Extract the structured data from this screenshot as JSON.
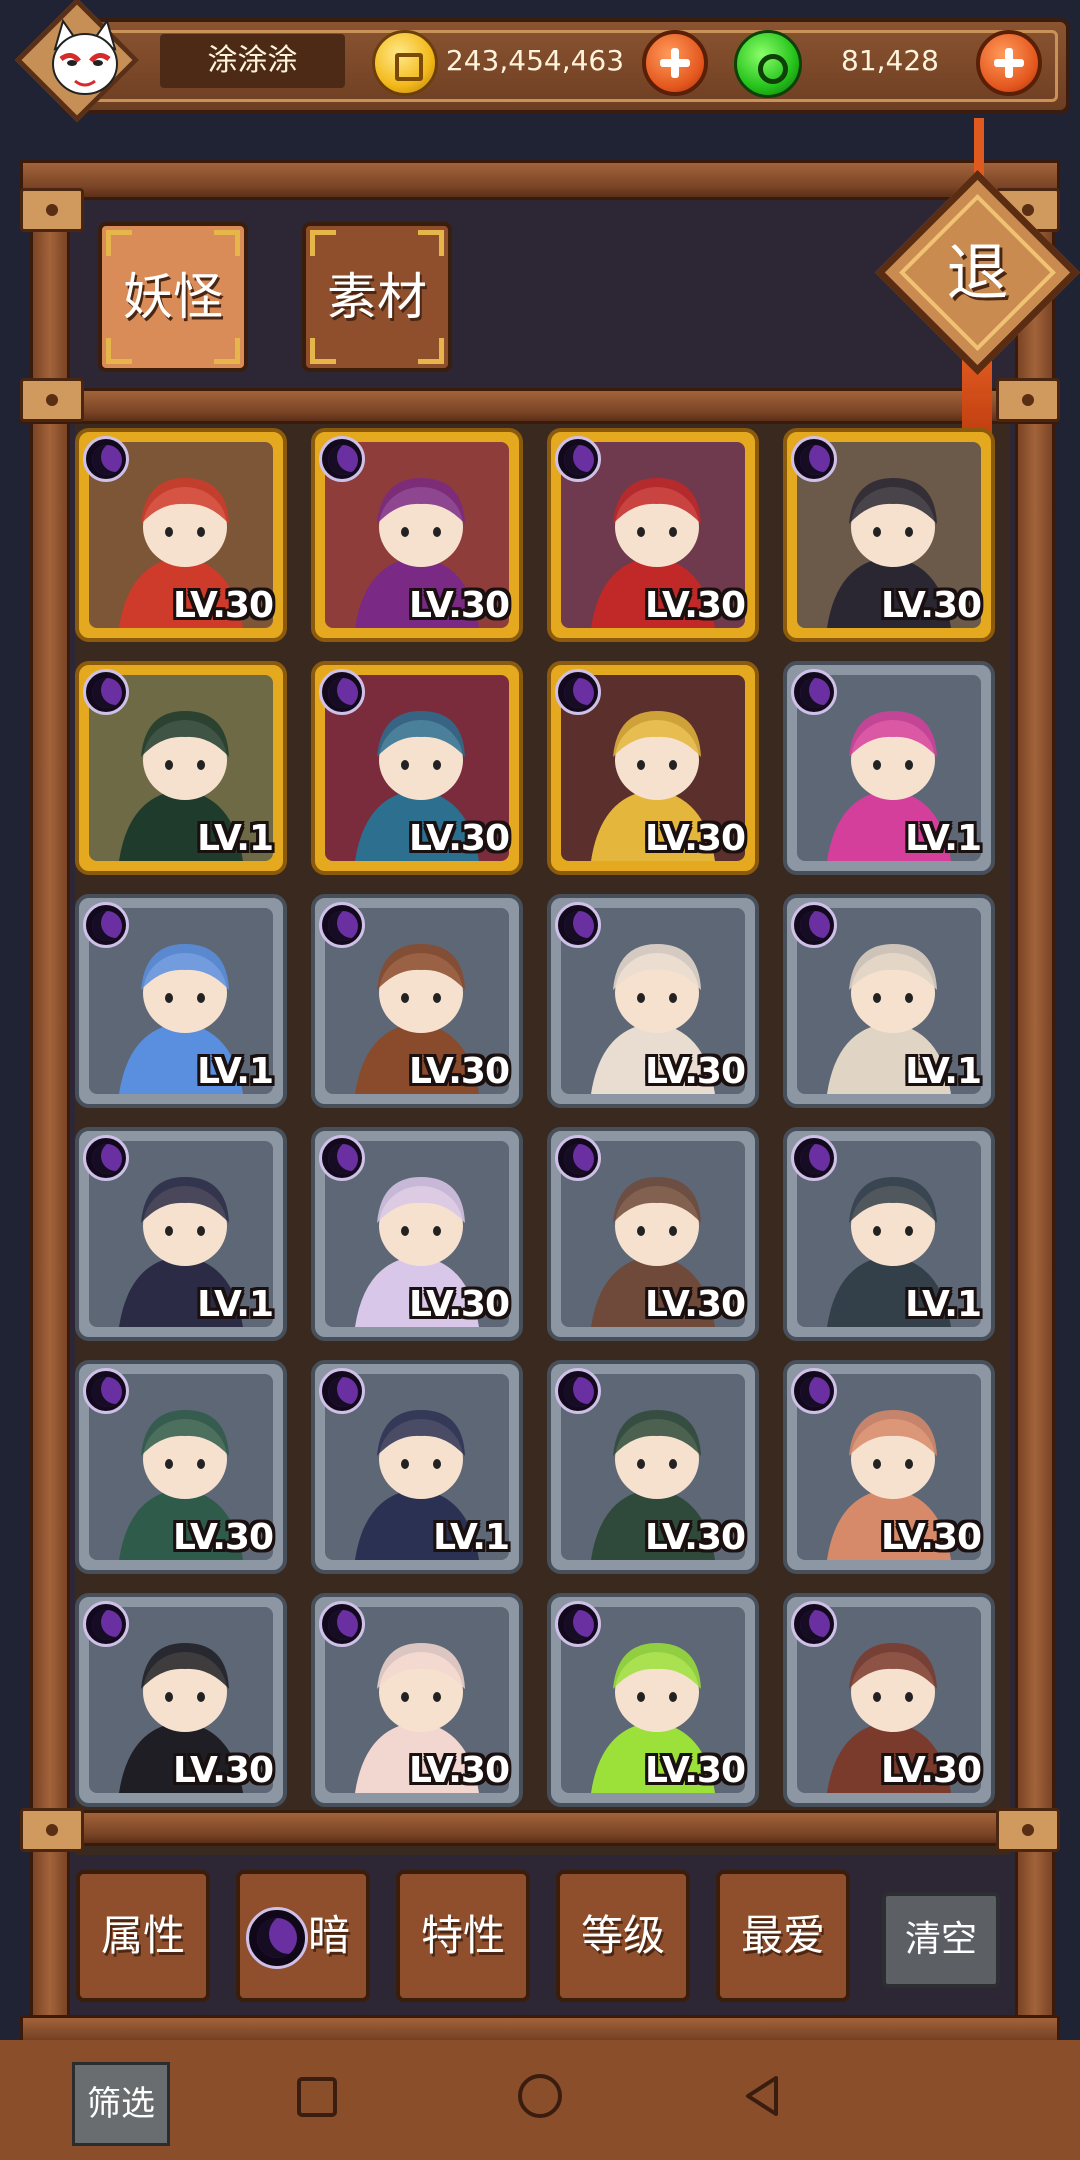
{
  "player": {
    "name": "涂涂涂",
    "gold": "243,454,463",
    "gems": "81,428"
  },
  "tabs": [
    {
      "label": "妖怪",
      "active": true
    },
    {
      "label": "素材",
      "active": false
    }
  ],
  "exit_label": "退",
  "cards": [
    {
      "level": "LV.30",
      "frame": "gold",
      "bg": "#7d5537",
      "accent": "#cf3b2a"
    },
    {
      "level": "LV.30",
      "frame": "gold",
      "bg": "#8e3d3b",
      "accent": "#7a2a84"
    },
    {
      "level": "LV.30",
      "frame": "gold",
      "bg": "#6f3a4e",
      "accent": "#c12828"
    },
    {
      "level": "LV.30",
      "frame": "gold",
      "bg": "#6b5a49",
      "accent": "#2a2733"
    },
    {
      "level": "LV.1",
      "frame": "gold",
      "bg": "#6d6a45",
      "accent": "#1f3b2c"
    },
    {
      "level": "LV.30",
      "frame": "gold",
      "bg": "#7a2c3c",
      "accent": "#2c6f8f"
    },
    {
      "level": "LV.30",
      "frame": "gold",
      "bg": "#5b2f2c",
      "accent": "#e4b63c"
    },
    {
      "level": "LV.1",
      "frame": "silver",
      "bg": "#5d6775",
      "accent": "#d53f9c"
    },
    {
      "level": "LV.1",
      "frame": "silver",
      "bg": "#5d6775",
      "accent": "#5a8fe0"
    },
    {
      "level": "LV.30",
      "frame": "silver",
      "bg": "#5d6775",
      "accent": "#8a4a2c"
    },
    {
      "level": "LV.30",
      "frame": "silver",
      "bg": "#5d6775",
      "accent": "#e9dcd0"
    },
    {
      "level": "LV.1",
      "frame": "silver",
      "bg": "#5d6775",
      "accent": "#e0d4c4"
    },
    {
      "level": "LV.1",
      "frame": "silver",
      "bg": "#5d6775",
      "accent": "#2b2b46"
    },
    {
      "level": "LV.30",
      "frame": "silver",
      "bg": "#5d6775",
      "accent": "#d8c7e8"
    },
    {
      "level": "LV.30",
      "frame": "silver",
      "bg": "#5d6775",
      "accent": "#6f4a3a"
    },
    {
      "level": "LV.1",
      "frame": "silver",
      "bg": "#5d6775",
      "accent": "#33404a"
    },
    {
      "level": "LV.30",
      "frame": "silver",
      "bg": "#5d6775",
      "accent": "#2f5b4a"
    },
    {
      "level": "LV.1",
      "frame": "silver",
      "bg": "#5d6775",
      "accent": "#2b3152"
    },
    {
      "level": "LV.30",
      "frame": "silver",
      "bg": "#5d6775",
      "accent": "#2f4a3a"
    },
    {
      "level": "LV.30",
      "frame": "silver",
      "bg": "#5d6775",
      "accent": "#d78a6a"
    },
    {
      "level": "LV.30",
      "frame": "silver",
      "bg": "#5d6775",
      "accent": "#1e1e24"
    },
    {
      "level": "LV.30",
      "frame": "silver",
      "bg": "#5d6775",
      "accent": "#f2d7d0"
    },
    {
      "level": "LV.30",
      "frame": "silver",
      "bg": "#5d6775",
      "accent": "#9be13a"
    },
    {
      "level": "LV.30",
      "frame": "silver",
      "bg": "#5d6775",
      "accent": "#7a3a2c"
    }
  ],
  "filters": {
    "attribute": "属性",
    "dark": "暗",
    "trait": "特性",
    "level": "等级",
    "favorite": "最爱",
    "clear": "清空"
  },
  "screen_filter": "筛选",
  "colors": {
    "wood": "#8a5431",
    "gold_frame": "#e5a91f",
    "silver_frame": "#8d97a3",
    "dark_element": "#6a2fa0"
  }
}
